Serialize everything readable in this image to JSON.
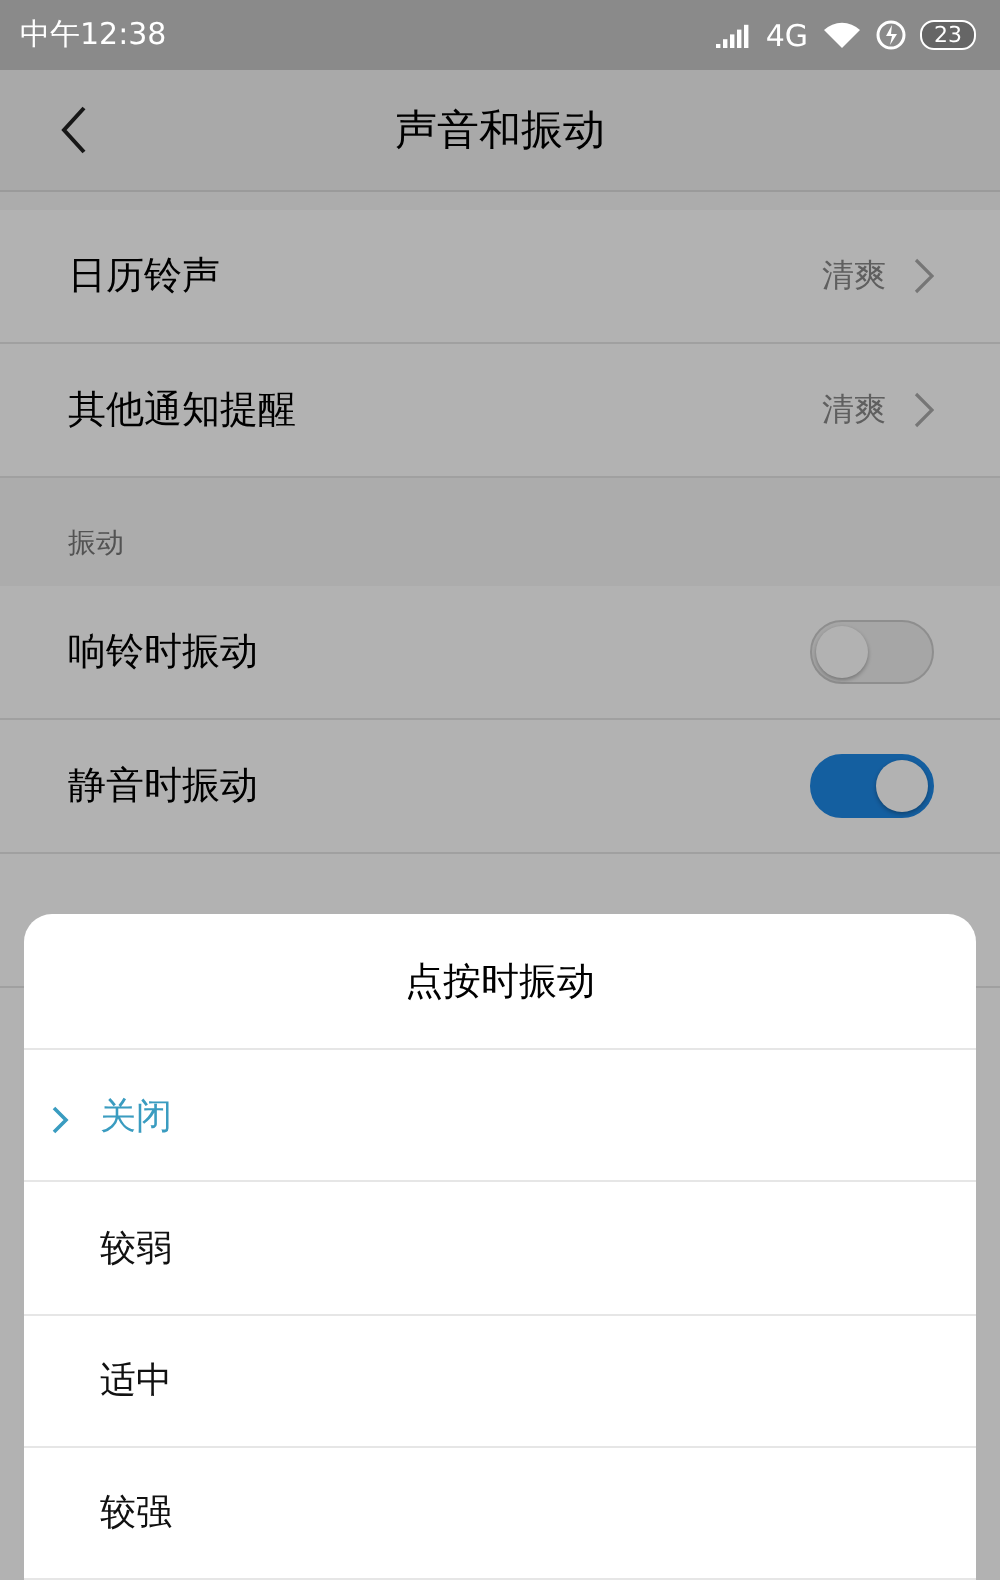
{
  "status_bar": {
    "time": "中午12:38",
    "network": "4G",
    "battery": "23"
  },
  "header": {
    "title": "声音和振动"
  },
  "ringtone_rows": [
    {
      "label": "日历铃声",
      "value": "清爽"
    },
    {
      "label": "其他通知提醒",
      "value": "清爽"
    }
  ],
  "vibration_section": {
    "title": "振动",
    "rows": [
      {
        "label": "响铃时振动",
        "on": false
      },
      {
        "label": "静音时振动",
        "on": true
      }
    ]
  },
  "dialog": {
    "title": "点按时振动",
    "options": [
      {
        "label": "关闭",
        "selected": true
      },
      {
        "label": "较弱",
        "selected": false
      },
      {
        "label": "适中",
        "selected": false
      },
      {
        "label": "较强",
        "selected": false
      }
    ]
  }
}
